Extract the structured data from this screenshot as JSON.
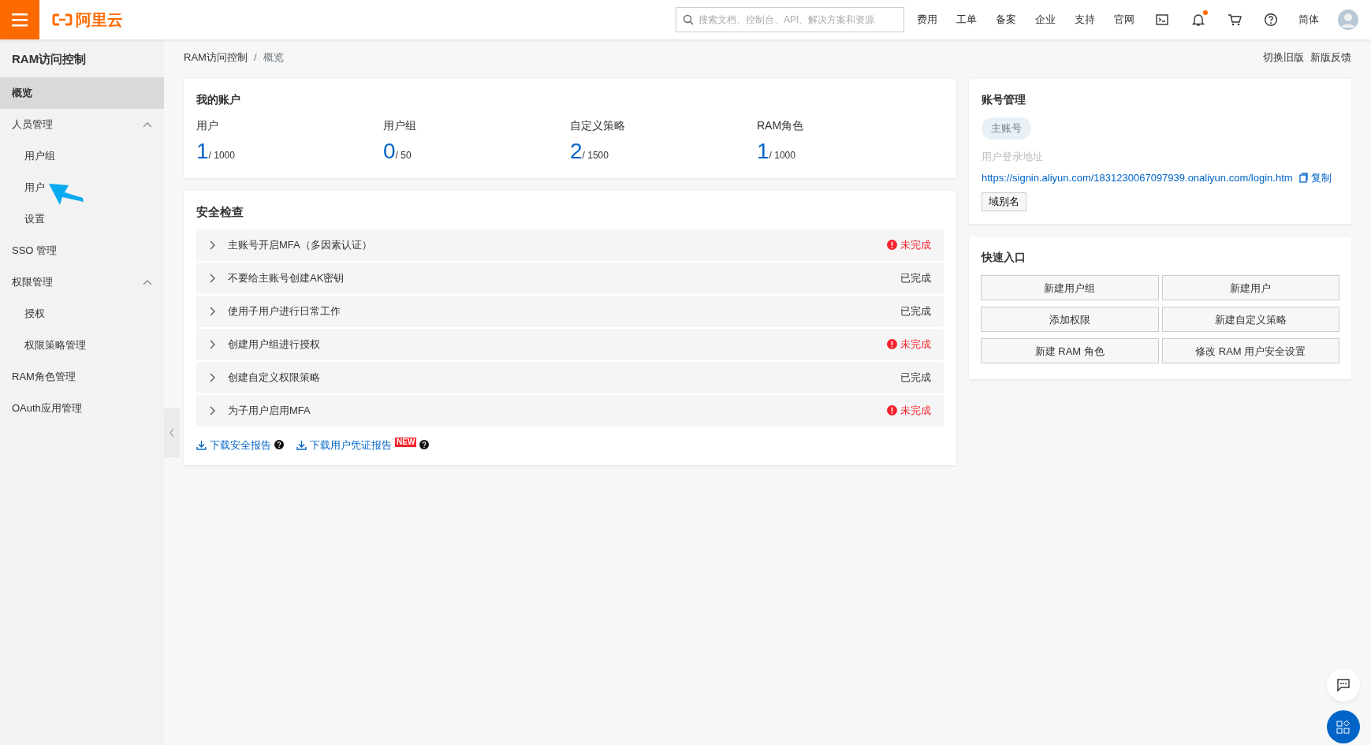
{
  "topbar": {
    "logo_text": "阿里云",
    "search": {
      "placeholder": "搜索文档、控制台、API、解决方案和资源"
    },
    "nav": [
      "费用",
      "工单",
      "备案",
      "企业",
      "支持",
      "官网"
    ],
    "has_notification": true,
    "language": "简体"
  },
  "sidebar": {
    "title": "RAM访问控制",
    "items": [
      {
        "label": "概览",
        "selected": true
      },
      {
        "label": "人员管理",
        "selected": false,
        "expanded": true,
        "children": [
          {
            "label": "用户组",
            "selected": false
          },
          {
            "label": "用户",
            "selected": false
          },
          {
            "label": "设置",
            "selected": false
          }
        ]
      },
      {
        "label": "SSO 管理",
        "selected": false
      },
      {
        "label": "权限管理",
        "selected": false,
        "expanded": true,
        "children": [
          {
            "label": "授权",
            "selected": false
          },
          {
            "label": "权限策略管理",
            "selected": false
          }
        ]
      },
      {
        "label": "RAM角色管理",
        "selected": false
      },
      {
        "label": "OAuth应用管理",
        "selected": false
      }
    ]
  },
  "breadcrumb": [
    "RAM访问控制",
    "概览"
  ],
  "breadcrumb_separator": "/",
  "header_links": [
    "切换旧版",
    "新版反馈"
  ],
  "my_account": {
    "title": "我的账户",
    "stats": [
      {
        "label": "用户",
        "value": "1",
        "total": "/ 1000"
      },
      {
        "label": "用户组",
        "value": "0",
        "total": "/ 50"
      },
      {
        "label": "自定义策略",
        "value": "2",
        "total": "/ 1500"
      },
      {
        "label": "RAM角色",
        "value": "1",
        "total": "/ 1000"
      }
    ]
  },
  "security_check": {
    "title": "安全检查",
    "items": [
      {
        "label": "主账号开启MFA（多因素认证）",
        "done": false,
        "status": "未完成"
      },
      {
        "label": "不要给主账号创建AK密钥",
        "done": true,
        "status": "已完成"
      },
      {
        "label": "使用子用户进行日常工作",
        "done": true,
        "status": "已完成"
      },
      {
        "label": "创建用户组进行授权",
        "done": false,
        "status": "未完成"
      },
      {
        "label": "创建自定义权限策略",
        "done": true,
        "status": "已完成"
      },
      {
        "label": "为子用户启用MFA",
        "done": false,
        "status": "未完成"
      }
    ],
    "links": [
      {
        "label": "下载安全报告"
      },
      {
        "label": "下载用户凭证报告",
        "badge": "NEW"
      }
    ]
  },
  "account_management": {
    "title": "账号管理",
    "tag": "主账号",
    "login_label": "用户登录地址",
    "login_url": "https://signin.aliyun.com/1831230067097939.onaliyun.com/login.htm",
    "copy_label": "复制",
    "alias_button": "域别名"
  },
  "quick_entry": {
    "title": "快速入口",
    "buttons": [
      "新建用户组",
      "新建用户",
      "添加权限",
      "新建自定义策略",
      "新建 RAM 角色",
      "修改 RAM 用户安全设置"
    ]
  }
}
